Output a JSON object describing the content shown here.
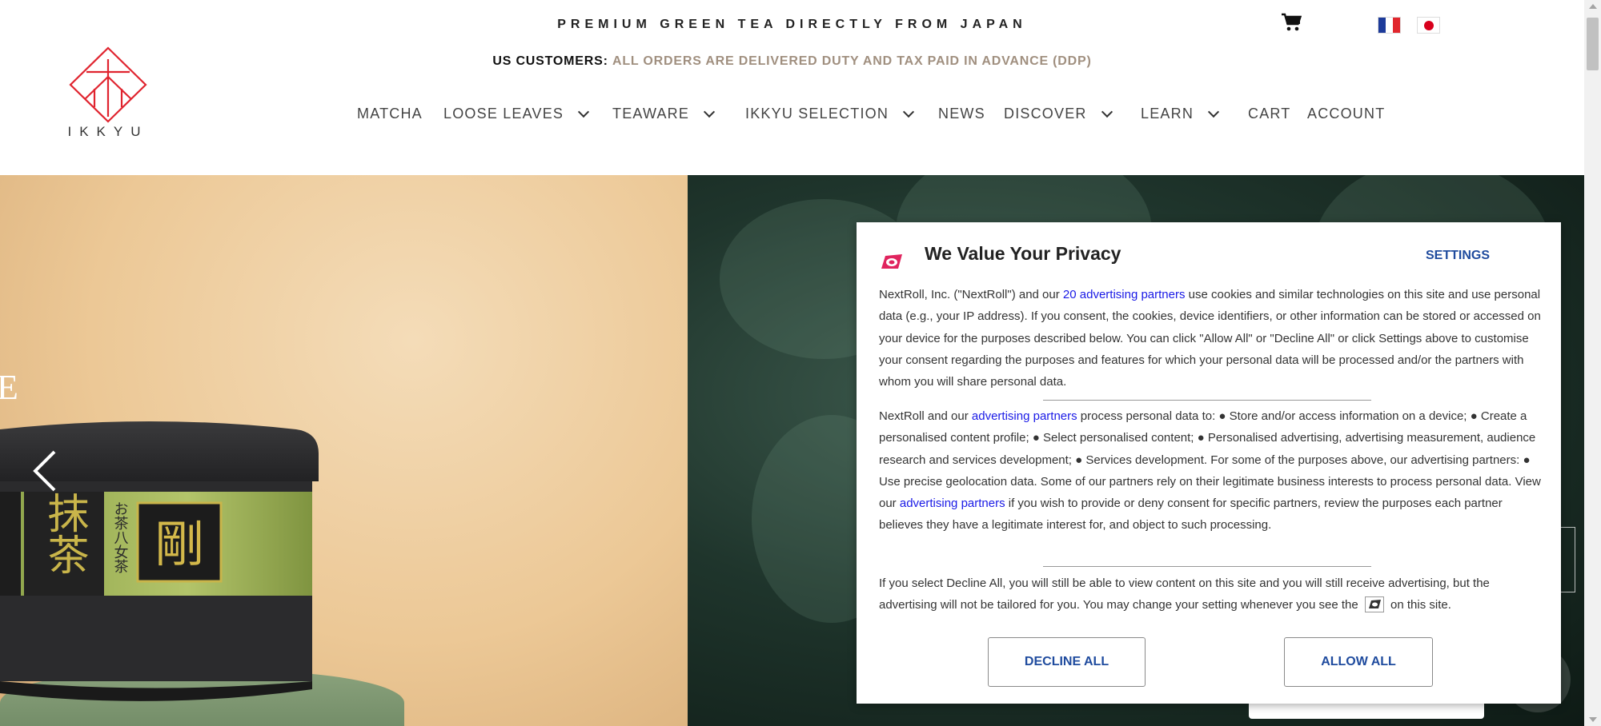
{
  "header": {
    "tagline": "PREMIUM GREEN TEA DIRECTLY FROM JAPAN",
    "notice_lead": "US CUSTOMERS:",
    "notice_rest": "ALL ORDERS ARE DELIVERED DUTY AND TAX PAID IN ADVANCE (DDP)",
    "logo_text": "IKKYU",
    "icons": {
      "cart": "cart-icon",
      "flag_fr": "france-flag-icon",
      "flag_jp": "japan-flag-icon"
    }
  },
  "nav": {
    "items": [
      {
        "label": "MATCHA",
        "dropdown": false
      },
      {
        "label": "LOOSE LEAVES",
        "dropdown": true
      },
      {
        "label": "TEAWARE",
        "dropdown": true
      },
      {
        "label": "IKKYU SELECTION",
        "dropdown": true
      },
      {
        "label": "NEWS",
        "dropdown": false
      },
      {
        "label": "DISCOVER",
        "dropdown": true
      },
      {
        "label": "LEARN",
        "dropdown": true
      },
      {
        "label": "CART",
        "dropdown": false
      },
      {
        "label": "ACCOUNT",
        "dropdown": false
      }
    ]
  },
  "hero": {
    "edge_letter": "E",
    "tin_label": "抹茶",
    "tin_kanji": "剛",
    "tin_side_text": "お茶八女茶"
  },
  "privacy": {
    "title": "We Value Your Privacy",
    "settings": "SETTINGS",
    "p1_a": "NextRoll, Inc. (\"NextRoll\") and our ",
    "p1_link": "20 advertising partners",
    "p1_b": " use cookies and similar technologies on this site and use personal data (e.g., your IP address). If you consent, the cookies, device identifiers, or other information can be stored or accessed on your device for the purposes described below. You can click \"Allow All\" or \"Decline All\" or click Settings above to customise your consent regarding the purposes and features for which your personal data will be processed and/or the partners with whom you will share personal data.",
    "p2_a": "NextRoll and our ",
    "p2_link1": "advertising partners",
    "p2_b": " process personal data to: ● Store and/or access information on a device; ● Create a personalised content profile; ● Select personalised content; ● Personalised advertising, advertising measurement, audience research and services development; ● Services development. For some of the purposes above, our advertising partners: ● Use precise geolocation data. Some of our partners rely on their legitimate business interests to process personal data. View our ",
    "p2_link2": "advertising partners",
    "p2_c": " if you wish to provide or deny consent for specific partners, review the purposes each partner believes they have a legitimate interest for, and object to such processing.",
    "p3_a": "If you select Decline All, you will still be able to view content on this site and you will still receive advertising, but the advertising will not be tailored for you. You may change your setting whenever you see the ",
    "p3_b": " on this site.",
    "decline": "DECLINE ALL",
    "allow": "ALLOW ALL"
  },
  "colors": {
    "accent_brown": "#a08f7f",
    "link_blue": "#1a1ae6",
    "button_blue": "#1f4b9e",
    "logo_red": "#e0242f"
  }
}
